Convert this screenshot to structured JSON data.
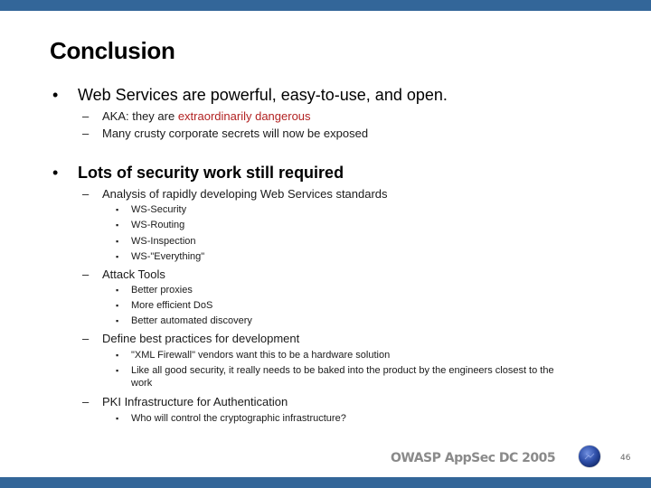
{
  "slide": {
    "title": "Conclusion",
    "bullets": [
      {
        "text": "Web Services are powerful, easy-to-use, and open.",
        "bold": false,
        "subs": [
          {
            "text_plain": "AKA: they are ",
            "text_highlight": "extraordinarily dangerous"
          },
          {
            "text_plain": "Many crusty corporate secrets will now be exposed"
          }
        ]
      },
      {
        "text": "Lots of security work still required",
        "bold": true,
        "subs": [
          {
            "text": "Analysis of rapidly developing Web Services standards",
            "items": [
              "WS-Security",
              "WS-Routing",
              "WS-Inspection",
              "WS-\"Everything\""
            ]
          },
          {
            "text": "Attack Tools",
            "items": [
              "Better proxies",
              "More efficient DoS",
              "Better automated discovery"
            ]
          },
          {
            "text": "Define best practices for development",
            "items": [
              "\"XML Firewall\" vendors want this to be a hardware solution",
              "Like all good security, it really needs to be baked into the product by the engineers closest to the",
              "work"
            ]
          },
          {
            "text": "PKI Infrastructure for Authentication",
            "items": [
              "Who will control the cryptographic infrastructure?"
            ]
          }
        ]
      }
    ],
    "bullet_glyph": "•",
    "dash_glyph": "–",
    "square_glyph": "▪"
  },
  "footer": {
    "conference": "OWASP AppSec DC 2005",
    "logo_icon": "owasp-globe-icon",
    "page_number": "46"
  },
  "colors": {
    "bar": "#336699",
    "highlight": "#b22222",
    "footer_text": "#8a8a8a"
  }
}
